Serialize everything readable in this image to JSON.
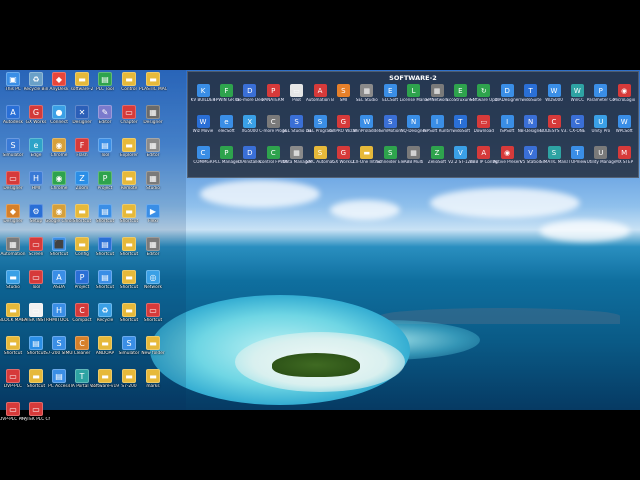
{
  "folder_title": "SOFTWARE-2",
  "desktop_icons": [
    {
      "label": "This PC",
      "color": "#3a8ee6",
      "glyph": "▣"
    },
    {
      "label": "Recycle Bin",
      "color": "#6aa0c8",
      "glyph": "♻"
    },
    {
      "label": "AnyDesk",
      "color": "#e8463a",
      "glyph": "◆"
    },
    {
      "label": "software-2",
      "color": "#e6b93a",
      "glyph": "▬"
    },
    {
      "label": "PLC Tool",
      "color": "#2ea34d",
      "glyph": "▤"
    },
    {
      "label": "Control",
      "color": "#e6b93a",
      "glyph": "▬"
    },
    {
      "label": "PLASTIC MACHINE",
      "color": "#e6b93a",
      "glyph": "▬"
    },
    {
      "label": "Autodesk",
      "color": "#2a6fd6",
      "glyph": "A"
    },
    {
      "label": "GX Works",
      "color": "#d23a3a",
      "glyph": "G"
    },
    {
      "label": "Connect",
      "color": "#3aa0e6",
      "glyph": "●"
    },
    {
      "label": "Designer",
      "color": "#2b5fb8",
      "glyph": "✕"
    },
    {
      "label": "Editor",
      "color": "#7a7acc",
      "glyph": "✎"
    },
    {
      "label": "Chapter",
      "color": "#d63a3a",
      "glyph": "▭"
    },
    {
      "label": "Designer",
      "color": "#6a6a6a",
      "glyph": "▦"
    },
    {
      "label": "Simulator",
      "color": "#3a7ad6",
      "glyph": "S"
    },
    {
      "label": "Edge",
      "color": "#2ea3c8",
      "glyph": "e"
    },
    {
      "label": "Chrome",
      "color": "#d6a03a",
      "glyph": "◉"
    },
    {
      "label": "Flash",
      "color": "#d63a3a",
      "glyph": "F"
    },
    {
      "label": "Tool",
      "color": "#3a8ee6",
      "glyph": "▤"
    },
    {
      "label": "Explorer",
      "color": "#e6b93a",
      "glyph": "▬"
    },
    {
      "label": "Editor",
      "color": "#8a8a8a",
      "glyph": "▦"
    },
    {
      "label": "Designer",
      "color": "#d63a3a",
      "glyph": "▭"
    },
    {
      "label": "HMI",
      "color": "#3a7ad6",
      "glyph": "H"
    },
    {
      "label": "Chrome",
      "color": "#2ea34d",
      "glyph": "◉"
    },
    {
      "label": "Zoom",
      "color": "#2a8ee6",
      "glyph": "Z"
    },
    {
      "label": "Project",
      "color": "#2ea34d",
      "glyph": "P"
    },
    {
      "label": "Remote",
      "color": "#e6b93a",
      "glyph": "▬"
    },
    {
      "label": "Studio",
      "color": "#7a7a7a",
      "glyph": "▦"
    },
    {
      "label": "Designer",
      "color": "#d6802a",
      "glyph": "◆"
    },
    {
      "label": "Setup",
      "color": "#2a6fd6",
      "glyph": "⚙"
    },
    {
      "label": "Google Chrome",
      "color": "#d6a03a",
      "glyph": "◉"
    },
    {
      "label": "Shortcut",
      "color": "#e6b93a",
      "glyph": "▬"
    },
    {
      "label": "Shortcut",
      "color": "#3a8ee6",
      "glyph": "▤"
    },
    {
      "label": "Shortcut",
      "color": "#e6b93a",
      "glyph": "▬"
    },
    {
      "label": "Flexi",
      "color": "#3a8ee6",
      "glyph": "▶"
    },
    {
      "label": "Automation",
      "color": "#7a7a7a",
      "glyph": "▦"
    },
    {
      "label": "Screen",
      "color": "#d63a3a",
      "glyph": "▭"
    },
    {
      "label": "Shortcut",
      "color": "#3a8ee6",
      "glyph": "⬛"
    },
    {
      "label": "Config",
      "color": "#e6b93a",
      "glyph": "▬"
    },
    {
      "label": "Shortcut",
      "color": "#2a6fd6",
      "glyph": "▤"
    },
    {
      "label": "Shortcut",
      "color": "#e6b93a",
      "glyph": "▬"
    },
    {
      "label": "Editor",
      "color": "#7a7a7a",
      "glyph": "▦"
    },
    {
      "label": "Studio",
      "color": "#3aa0e6",
      "glyph": "▬"
    },
    {
      "label": "Tool",
      "color": "#d63a3a",
      "glyph": "▭"
    },
    {
      "label": "ASDA",
      "color": "#3a8ee6",
      "glyph": "A"
    },
    {
      "label": "Project",
      "color": "#2a6fd6",
      "glyph": "P"
    },
    {
      "label": "Shortcut",
      "color": "#3a8ee6",
      "glyph": "▤"
    },
    {
      "label": "Shortcut",
      "color": "#e6b93a",
      "glyph": "▬"
    },
    {
      "label": "Network",
      "color": "#3aa0e6",
      "glyph": "◎"
    },
    {
      "label": "BLOCK MACHINE",
      "color": "#e6b93a",
      "glyph": "▬"
    },
    {
      "label": "FATEK INSTRUCTION",
      "color": "#f2f2f2",
      "glyph": "▭"
    },
    {
      "label": "HMITOOL",
      "color": "#3a8ee6",
      "glyph": "H"
    },
    {
      "label": "Compact",
      "color": "#d63a3a",
      "glyph": "C"
    },
    {
      "label": "Recycle",
      "color": "#3aa0e6",
      "glyph": "♻"
    },
    {
      "label": "Shortcut",
      "color": "#e6b93a",
      "glyph": "▬"
    },
    {
      "label": "Shortcut",
      "color": "#d63a3a",
      "glyph": "▭"
    },
    {
      "label": "Shortcut",
      "color": "#e6b93a",
      "glyph": "▬"
    },
    {
      "label": "Shortcut",
      "color": "#2a8ee6",
      "glyph": "▤"
    },
    {
      "label": "S7-200 SIMULA",
      "color": "#3a8ee6",
      "glyph": "S"
    },
    {
      "label": "Cleaner",
      "color": "#d6802a",
      "glyph": "C"
    },
    {
      "label": "ANDOAP",
      "color": "#e6b93a",
      "glyph": "▬"
    },
    {
      "label": "Simulator",
      "color": "#3a8ee6",
      "glyph": "S"
    },
    {
      "label": "New folder",
      "color": "#e6b93a",
      "glyph": "▬"
    },
    {
      "label": "DVP-PLC",
      "color": "#d63a3a",
      "glyph": "▭"
    },
    {
      "label": "Shortcut",
      "color": "#e6b93a",
      "glyph": "▬"
    },
    {
      "label": "PC Access",
      "color": "#3a8ee6",
      "glyph": "▤"
    },
    {
      "label": "TIA Portal V12",
      "color": "#2ea3a3",
      "glyph": "T"
    },
    {
      "label": "software-v19",
      "color": "#e6b93a",
      "glyph": "▬"
    },
    {
      "label": "S7-200",
      "color": "#e6b93a",
      "glyph": "▬"
    },
    {
      "label": "marks",
      "color": "#e6b93a",
      "glyph": "▬"
    },
    {
      "label": "DVP-PLC PM_EN",
      "color": "#d63a3a",
      "glyph": "▭"
    },
    {
      "label": "FATEK PLC Chapter",
      "color": "#d63a3a",
      "glyph": "▭"
    }
  ],
  "window_icons": [
    {
      "label": "KV BUILDER",
      "color": "#3a8ee6",
      "glyph": "K"
    },
    {
      "label": "FPWIN GR7S",
      "color": "#2ea34d",
      "glyph": "F"
    },
    {
      "label": "Do-more Designer",
      "color": "#3a6fd6",
      "glyph": "D"
    },
    {
      "label": "PANATERM",
      "color": "#d63a3a",
      "glyph": "P"
    },
    {
      "label": "Pilot",
      "color": "#e6e6e6",
      "glyph": "▭"
    },
    {
      "label": "Automation Builder",
      "color": "#d63a3a",
      "glyph": "A"
    },
    {
      "label": "SMI",
      "color": "#e6802a",
      "glyph": "S"
    },
    {
      "label": "SEL Studio",
      "color": "#8a8a8a",
      "glyph": "▦"
    },
    {
      "label": "ELCSoft",
      "color": "#3a8ee6",
      "glyph": "E"
    },
    {
      "label": "License Manager",
      "color": "#2ea34d",
      "glyph": "L"
    },
    {
      "label": "SMNetwork",
      "color": "#7a7a7a",
      "glyph": "▦"
    },
    {
      "label": "EcoStruxure Machine",
      "color": "#2ea34d",
      "glyph": "E"
    },
    {
      "label": "Software Update",
      "color": "#2ea34d",
      "glyph": "↻"
    },
    {
      "label": "DIADesigner",
      "color": "#3a8ee6",
      "glyph": "D"
    },
    {
      "label": "TwidoSuite",
      "color": "#2a6fd6",
      "glyph": "T"
    },
    {
      "label": "WDS000",
      "color": "#3a8ee6",
      "glyph": "W"
    },
    {
      "label": "WinCC",
      "color": "#2ea3a3",
      "glyph": "W"
    },
    {
      "label": "Parameter Converter",
      "color": "#3a8ee6",
      "glyph": "P"
    },
    {
      "label": "MicroLogix",
      "color": "#d63a3a",
      "glyph": "◉"
    },
    {
      "label": "Wiz Movie",
      "color": "#2a6fd6",
      "glyph": "W"
    },
    {
      "label": "elecSoft",
      "color": "#3a8ee6",
      "glyph": "e"
    },
    {
      "label": "XG5000",
      "color": "#3aa0e6",
      "glyph": "X"
    },
    {
      "label": "C-more Programming",
      "color": "#7a7a7a",
      "glyph": "C"
    },
    {
      "label": "SEL Studio Download",
      "color": "#3a6fd6",
      "glyph": "S"
    },
    {
      "label": "SEL Program",
      "color": "#3a8ee6",
      "glyph": "S"
    },
    {
      "label": "GXPRO Wizard",
      "color": "#d63a3a",
      "glyph": "G"
    },
    {
      "label": "WinProladder",
      "color": "#3a8ee6",
      "glyph": "W"
    },
    {
      "label": "SimMotion",
      "color": "#3a6fd6",
      "glyph": "S"
    },
    {
      "label": "NQ-Designer",
      "color": "#3a8ee6",
      "glyph": "N"
    },
    {
      "label": "ISPSoft Runtime",
      "color": "#3a8ee6",
      "glyph": "I"
    },
    {
      "label": "TwidoSoft",
      "color": "#2a6fd6",
      "glyph": "T"
    },
    {
      "label": "Download",
      "color": "#d63a3a",
      "glyph": "▭"
    },
    {
      "label": "ISPSoft",
      "color": "#3a8ee6",
      "glyph": "I"
    },
    {
      "label": "NB-Designer",
      "color": "#3a6fd6",
      "glyph": "N"
    },
    {
      "label": "CODESYS V3.5",
      "color": "#d63a3a",
      "glyph": "C"
    },
    {
      "label": "CX-ONE",
      "color": "#3a6fd6",
      "glyph": "C"
    },
    {
      "label": "Unity Pro",
      "color": "#3aa0e6",
      "glyph": "U"
    },
    {
      "label": "WPLSoft",
      "color": "#3a8ee6",
      "glyph": "W"
    },
    {
      "label": "COMMGR",
      "color": "#3a8ee6",
      "glyph": "C"
    },
    {
      "label": "PLC Manager",
      "color": "#2ea34d",
      "glyph": "P"
    },
    {
      "label": "DIAInstaller",
      "color": "#3a6fd6",
      "glyph": "D"
    },
    {
      "label": "Control FPWIN",
      "color": "#2ea34d",
      "glyph": "C"
    },
    {
      "label": "Data Manager",
      "color": "#8a8a8a",
      "glyph": "▦"
    },
    {
      "label": "SMC Automation",
      "color": "#e6b93a",
      "glyph": "S"
    },
    {
      "label": "GX Works2",
      "color": "#d63a3a",
      "glyph": "G"
    },
    {
      "label": "CX-One Introduction",
      "color": "#e6b93a",
      "glyph": "▬"
    },
    {
      "label": "Schneider Electric",
      "color": "#2ea34d",
      "glyph": "S"
    },
    {
      "label": "ABB Multi",
      "color": "#7a7a7a",
      "glyph": "▦"
    },
    {
      "label": "ZelioSoft",
      "color": "#2ea34d",
      "glyph": "Z"
    },
    {
      "label": "V2.2 ST-120",
      "color": "#3aa0e6",
      "glyph": "V"
    },
    {
      "label": "ABB IP Config",
      "color": "#d63a3a",
      "glyph": "A"
    },
    {
      "label": "Active Presenter",
      "color": "#d63a3a",
      "glyph": "◉"
    },
    {
      "label": "V5 Station",
      "color": "#3a6fd6",
      "glyph": "V"
    },
    {
      "label": "SIMATIC Manager",
      "color": "#2ea3a3",
      "glyph": "S"
    },
    {
      "label": "TOPView",
      "color": "#3a8ee6",
      "glyph": "T"
    },
    {
      "label": "Utility Manager",
      "color": "#7a7a7a",
      "glyph": "U"
    },
    {
      "label": "MX STEP",
      "color": "#d63a3a",
      "glyph": "M"
    }
  ]
}
